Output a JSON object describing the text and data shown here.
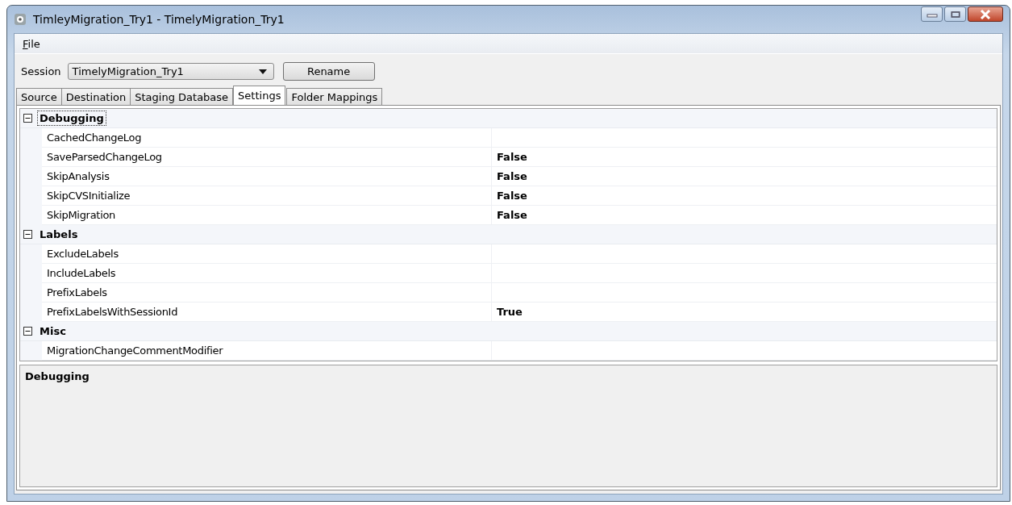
{
  "window": {
    "title": "TimleyMigration_Try1 - TimelyMigration_Try1"
  },
  "menu": [
    {
      "label": "File"
    }
  ],
  "session": {
    "label": "Session",
    "value": "TimelyMigration_Try1",
    "button": "Rename"
  },
  "tabs": [
    {
      "label": "Source",
      "selected": false
    },
    {
      "label": "Destination",
      "selected": false
    },
    {
      "label": "Staging Database",
      "selected": false
    },
    {
      "label": "Settings",
      "selected": true
    },
    {
      "label": "Folder Mappings",
      "selected": false
    }
  ],
  "property_grid": {
    "categories": [
      {
        "name": "Debugging",
        "expanded": true,
        "selected": true,
        "properties": [
          {
            "name": "CachedChangeLog",
            "selected": false
          },
          {
            "name": "SaveParsedChangeLog",
            "value": "False",
            "selected": false
          },
          {
            "name": "SkipAnalysis",
            "value": "False",
            "selected": false
          },
          {
            "name": "SkipCVSInitialize",
            "value": "False",
            "selected": false
          },
          {
            "name": "SkipMigration",
            "value": "False",
            "selected": false
          }
        ]
      },
      {
        "name": "Labels",
        "expanded": true,
        "selected": false,
        "properties": [
          {
            "name": "ExcludeLabels",
            "selected": false
          },
          {
            "name": "IncludeLabels",
            "selected": false
          },
          {
            "name": "PrefixLabels",
            "selected": false
          },
          {
            "name": "PrefixLabelsWithSessionId",
            "value": "True",
            "selected": false
          }
        ]
      },
      {
        "name": "Misc",
        "expanded": true,
        "selected": false,
        "properties": [
          {
            "name": "MigrationChangeCommentModifier",
            "selected": false
          }
        ]
      }
    ],
    "description": {
      "title": "Debugging"
    }
  }
}
